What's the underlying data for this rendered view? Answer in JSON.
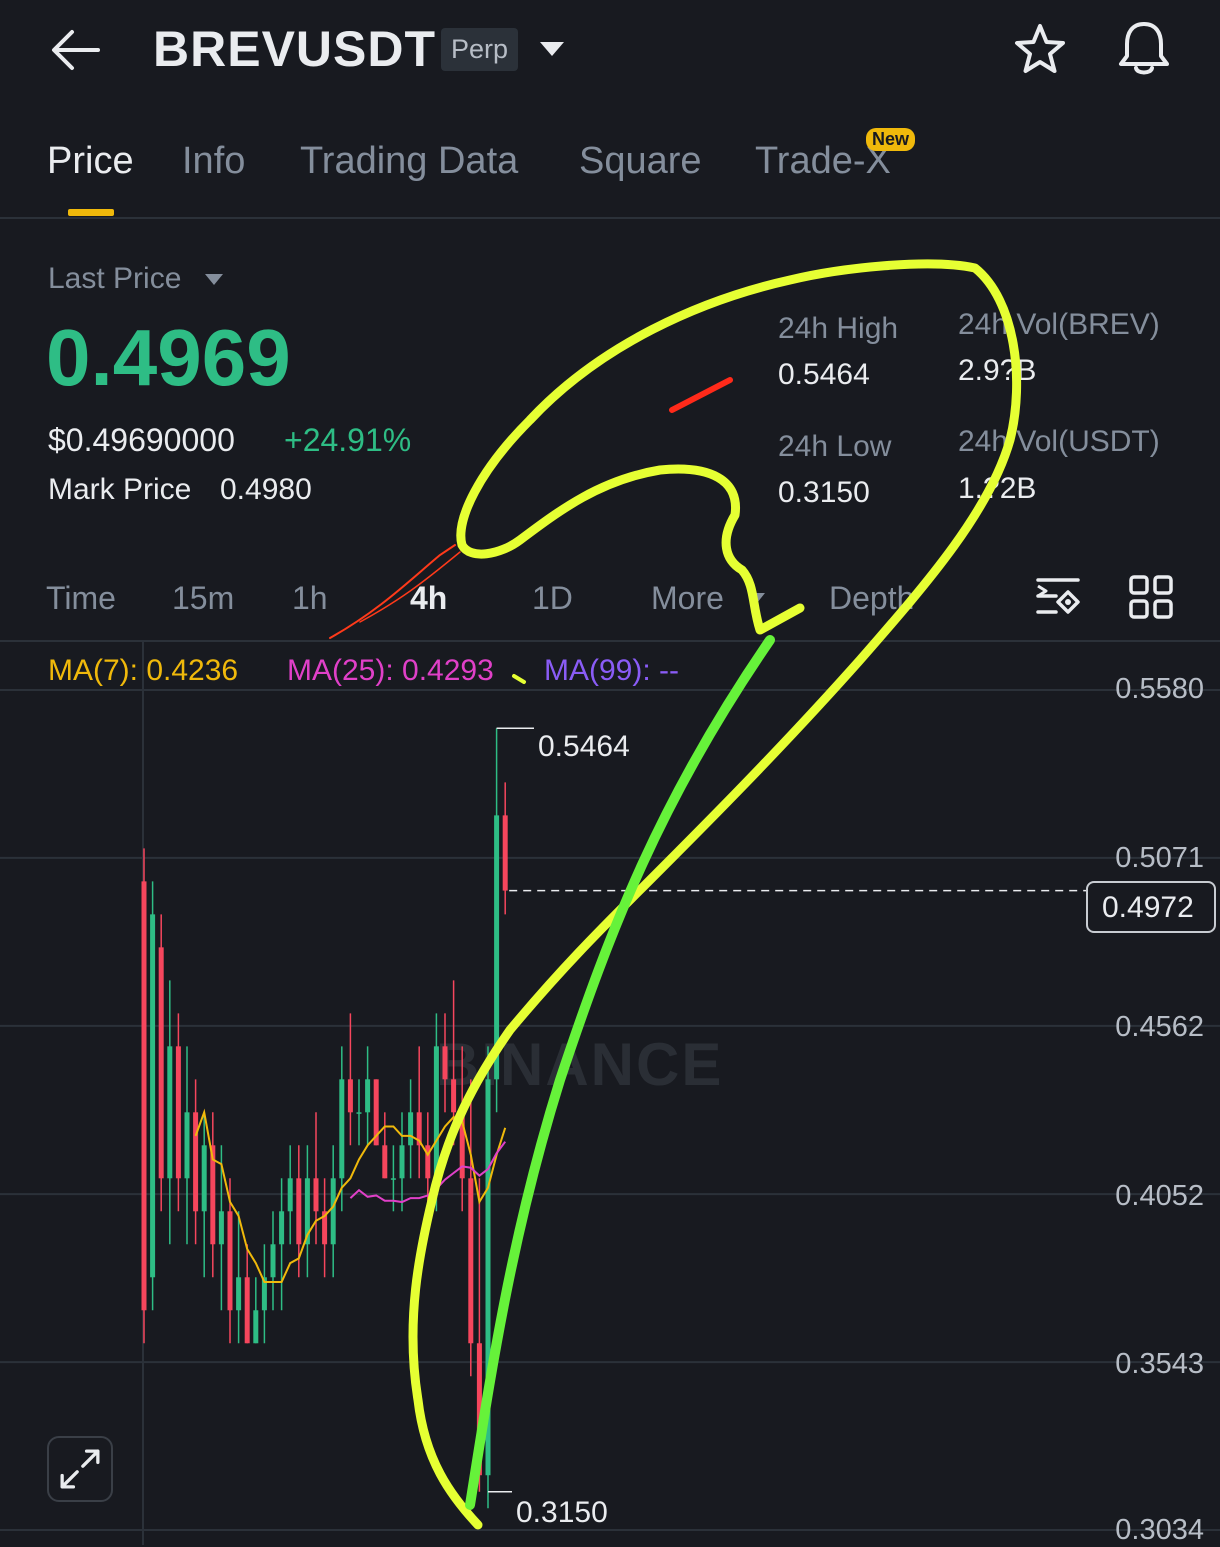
{
  "header": {
    "symbol": "BREVUSDT",
    "contract_type": "Perp"
  },
  "tabs": [
    {
      "label": "Price",
      "active": true
    },
    {
      "label": "Info",
      "active": false
    },
    {
      "label": "Trading Data",
      "active": false
    },
    {
      "label": "Square",
      "active": false
    },
    {
      "label": "Trade-X",
      "active": false,
      "badge": "New"
    }
  ],
  "price": {
    "last_price_label": "Last Price",
    "last_price": "0.4969",
    "usd_price": "$0.49690000",
    "change_pct": "+24.91%",
    "mark_price_label": "Mark Price",
    "mark_price": "0.4980"
  },
  "stats": {
    "high_label": "24h High",
    "high_value": "0.5464",
    "low_label": "24h Low",
    "low_value": "0.3150",
    "vol_base_label": "24h Vol(BREV)",
    "vol_base_value": "2.9?B",
    "vol_quote_label": "24h Vol(USDT)",
    "vol_quote_value": "1.?2B"
  },
  "intervals": [
    {
      "label": "Time",
      "active": false
    },
    {
      "label": "15m",
      "active": false
    },
    {
      "label": "1h",
      "active": false
    },
    {
      "label": "4h",
      "active": true
    },
    {
      "label": "1D",
      "active": false
    },
    {
      "label": "More",
      "active": false
    },
    {
      "label": "Depth",
      "active": false
    }
  ],
  "indicators": {
    "ma7": "MA(7): 0.4236",
    "ma25": "MA(25): 0.4293",
    "ma99": "MA(99): --"
  },
  "colors": {
    "up": "#2ebd85",
    "down": "#f6465d",
    "accent": "#f0b90b",
    "ma7": "#f0b90b",
    "ma25": "#e040c8",
    "ma99": "#8a5cf6"
  },
  "chart_data": {
    "type": "candlestick",
    "interval": "4h",
    "y_axis_ticks": [
      "0.5580",
      "0.5071",
      "0.4562",
      "0.4052",
      "0.3543",
      "0.3034"
    ],
    "ylim": [
      0.3034,
      0.558
    ],
    "current_price": "0.4972",
    "high_marker": "0.5464",
    "low_marker": "0.3150",
    "candles": [
      {
        "o": 0.5,
        "h": 0.51,
        "l": 0.36,
        "c": 0.37
      },
      {
        "o": 0.38,
        "h": 0.5,
        "l": 0.37,
        "c": 0.49
      },
      {
        "o": 0.48,
        "h": 0.49,
        "l": 0.4,
        "c": 0.41
      },
      {
        "o": 0.41,
        "h": 0.47,
        "l": 0.39,
        "c": 0.45
      },
      {
        "o": 0.45,
        "h": 0.46,
        "l": 0.4,
        "c": 0.41
      },
      {
        "o": 0.41,
        "h": 0.45,
        "l": 0.39,
        "c": 0.43
      },
      {
        "o": 0.43,
        "h": 0.44,
        "l": 0.39,
        "c": 0.4
      },
      {
        "o": 0.4,
        "h": 0.43,
        "l": 0.38,
        "c": 0.42
      },
      {
        "o": 0.42,
        "h": 0.43,
        "l": 0.38,
        "c": 0.39
      },
      {
        "o": 0.39,
        "h": 0.42,
        "l": 0.37,
        "c": 0.4
      },
      {
        "o": 0.4,
        "h": 0.41,
        "l": 0.36,
        "c": 0.37
      },
      {
        "o": 0.37,
        "h": 0.4,
        "l": 0.36,
        "c": 0.38
      },
      {
        "o": 0.38,
        "h": 0.39,
        "l": 0.36,
        "c": 0.36
      },
      {
        "o": 0.36,
        "h": 0.38,
        "l": 0.36,
        "c": 0.37
      },
      {
        "o": 0.37,
        "h": 0.39,
        "l": 0.36,
        "c": 0.38
      },
      {
        "o": 0.38,
        "h": 0.4,
        "l": 0.37,
        "c": 0.39
      },
      {
        "o": 0.39,
        "h": 0.41,
        "l": 0.37,
        "c": 0.4
      },
      {
        "o": 0.4,
        "h": 0.42,
        "l": 0.39,
        "c": 0.41
      },
      {
        "o": 0.41,
        "h": 0.42,
        "l": 0.38,
        "c": 0.39
      },
      {
        "o": 0.39,
        "h": 0.42,
        "l": 0.38,
        "c": 0.41
      },
      {
        "o": 0.41,
        "h": 0.43,
        "l": 0.39,
        "c": 0.4
      },
      {
        "o": 0.4,
        "h": 0.41,
        "l": 0.38,
        "c": 0.39
      },
      {
        "o": 0.39,
        "h": 0.42,
        "l": 0.38,
        "c": 0.41
      },
      {
        "o": 0.41,
        "h": 0.45,
        "l": 0.4,
        "c": 0.44
      },
      {
        "o": 0.44,
        "h": 0.46,
        "l": 0.42,
        "c": 0.43
      },
      {
        "o": 0.43,
        "h": 0.44,
        "l": 0.42,
        "c": 0.43
      },
      {
        "o": 0.43,
        "h": 0.45,
        "l": 0.42,
        "c": 0.44
      },
      {
        "o": 0.44,
        "h": 0.44,
        "l": 0.42,
        "c": 0.42
      },
      {
        "o": 0.42,
        "h": 0.43,
        "l": 0.41,
        "c": 0.41
      },
      {
        "o": 0.41,
        "h": 0.42,
        "l": 0.4,
        "c": 0.41
      },
      {
        "o": 0.41,
        "h": 0.43,
        "l": 0.4,
        "c": 0.42
      },
      {
        "o": 0.42,
        "h": 0.44,
        "l": 0.41,
        "c": 0.43
      },
      {
        "o": 0.43,
        "h": 0.45,
        "l": 0.41,
        "c": 0.42
      },
      {
        "o": 0.42,
        "h": 0.43,
        "l": 0.4,
        "c": 0.41
      },
      {
        "o": 0.41,
        "h": 0.46,
        "l": 0.4,
        "c": 0.45
      },
      {
        "o": 0.45,
        "h": 0.46,
        "l": 0.43,
        "c": 0.44
      },
      {
        "o": 0.44,
        "h": 0.47,
        "l": 0.42,
        "c": 0.43
      },
      {
        "o": 0.43,
        "h": 0.45,
        "l": 0.4,
        "c": 0.41
      },
      {
        "o": 0.41,
        "h": 0.44,
        "l": 0.35,
        "c": 0.36
      },
      {
        "o": 0.36,
        "h": 0.41,
        "l": 0.315,
        "c": 0.32
      },
      {
        "o": 0.32,
        "h": 0.45,
        "l": 0.31,
        "c": 0.44
      },
      {
        "o": 0.44,
        "h": 0.5464,
        "l": 0.43,
        "c": 0.52
      },
      {
        "o": 0.52,
        "h": 0.53,
        "l": 0.49,
        "c": 0.4972
      }
    ]
  },
  "watermark": "BINANCE"
}
